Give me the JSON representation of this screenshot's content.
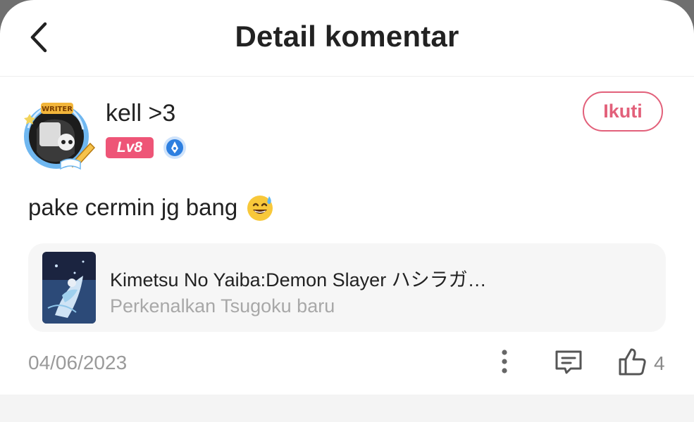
{
  "header": {
    "title": "Detail komentar"
  },
  "comment": {
    "username": "kell >3",
    "level": "Lv8",
    "avatar_badge": "WRITER",
    "follow_label": "Ikuti",
    "text": "pake cermin jg bang",
    "date": "04/06/2023",
    "likes": "4"
  },
  "book": {
    "title": "Kimetsu No Yaiba:Demon Slayer ハシラガ…",
    "chapter": "Perkenalkan Tsugoku baru"
  },
  "colors": {
    "accent": "#e2607a",
    "level_badge": "#ee5577",
    "writer_badge": "#2d7fe0"
  },
  "icons": [
    "back-arrow-icon",
    "pen-badge-icon",
    "sweat-smile-emoji",
    "more-vertical-icon",
    "comment-icon",
    "thumbs-up-icon"
  ]
}
